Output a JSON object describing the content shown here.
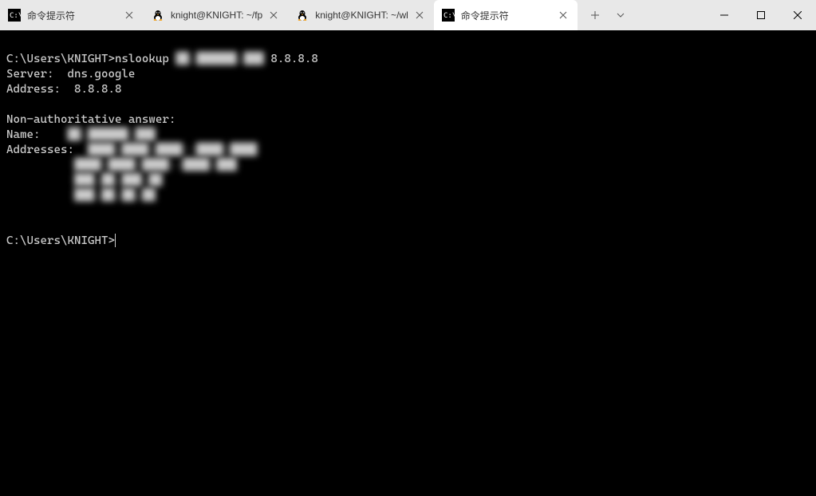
{
  "tabs": [
    {
      "title": "命令提示符",
      "icon": "cmd"
    },
    {
      "title": "knight@KNIGHT: ~/fp",
      "icon": "tux"
    },
    {
      "title": "knight@KNIGHT: ~/wl",
      "icon": "tux"
    },
    {
      "title": "命令提示符",
      "icon": "cmd",
      "active": true
    }
  ],
  "terminal": {
    "blank0": "",
    "prompt1": "C:\\Users\\KNIGHT>nslookup ",
    "arg_blur": "██.██████.███",
    "arg_end": " 8.8.8.8",
    "server_line": "Server:  dns.google",
    "address_line": "Address:  8.8.8.8",
    "blank1": "",
    "nonauth": "Non-authoritative answer:",
    "name_label": "Name:    ",
    "name_blur": "██.██████.███",
    "addr_label": "Addresses:  ",
    "addr1_blur": "████:████:████::████:████",
    "pad": "          ",
    "addr2_blur": "████:████:████::████:███",
    "addr3_blur": "███.██.███.██",
    "addr4_blur": "███.██.██.██",
    "blank2": "",
    "blank3": "",
    "prompt2": "C:\\Users\\KNIGHT>"
  }
}
